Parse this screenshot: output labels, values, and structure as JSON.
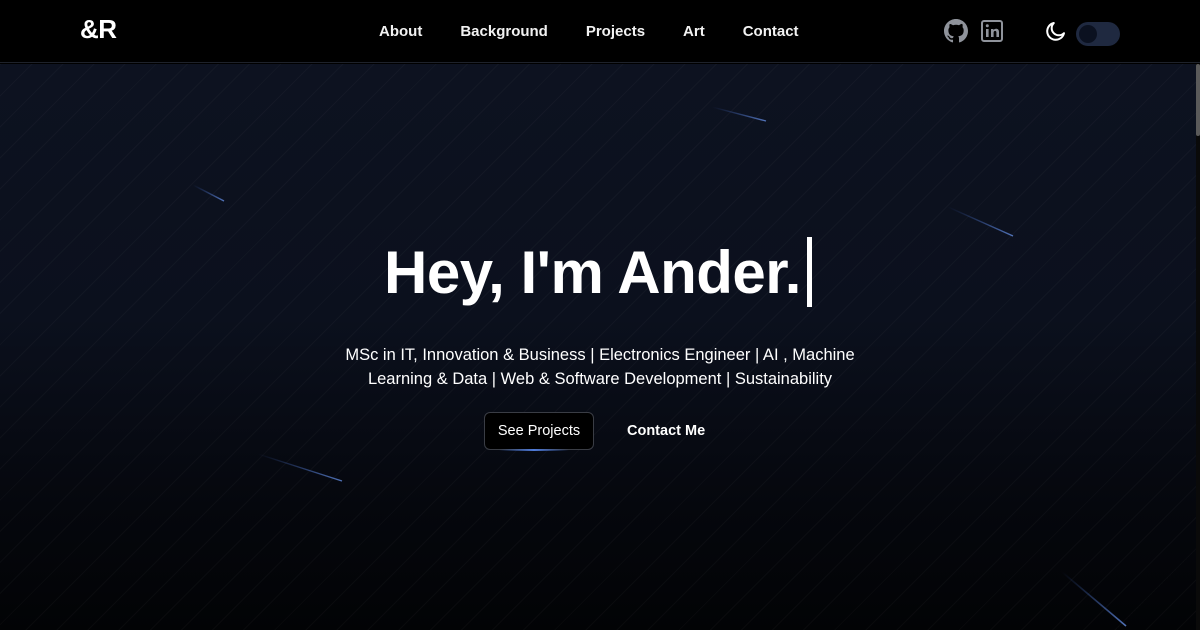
{
  "nav": {
    "logo": "&R",
    "links": [
      "About",
      "Background",
      "Projects",
      "Art",
      "Contact"
    ],
    "social_icons": [
      "github-icon",
      "linkedin-icon"
    ],
    "theme_icon": "moon-icon"
  },
  "hero": {
    "title": "Hey, I'm Ander.",
    "subtitle": "MSc in IT, Innovation & Business | Electronics Engineer | AI , Machine Learning & Data | Web & Software Development | Sustainability",
    "primary_button": "See Projects",
    "secondary_button": "Contact Me"
  },
  "colors": {
    "background": "#000000",
    "hero_bg": "#0b101d",
    "accent": "#4f7bd9",
    "text": "#ffffff"
  }
}
